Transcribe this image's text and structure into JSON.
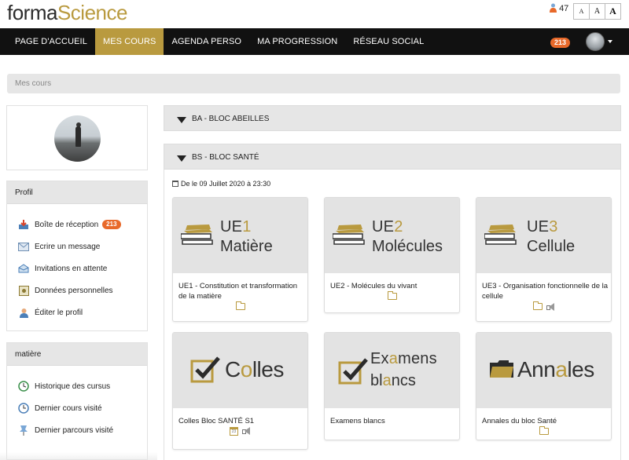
{
  "brand": {
    "part1": "forma",
    "part2": "Science"
  },
  "header": {
    "notifications_count": "47",
    "font_sizes": [
      "A",
      "A",
      "A"
    ]
  },
  "nav": {
    "items": [
      {
        "label": "PAGE D'ACCUEIL",
        "active": false
      },
      {
        "label": "MES COURS",
        "active": true
      },
      {
        "label": "AGENDA PERSO",
        "active": false
      },
      {
        "label": "MA PROGRESSION",
        "active": false
      },
      {
        "label": "RÉSEAU SOCIAL",
        "active": false
      }
    ],
    "badge": "213"
  },
  "breadcrumb": "Mes cours",
  "sidebar": {
    "profil": {
      "title": "Profil",
      "items": [
        {
          "label": "Boîte de réception",
          "count": "213",
          "icon": "inbox-icon"
        },
        {
          "label": "Ecrire un message",
          "icon": "envelope-icon"
        },
        {
          "label": "Invitations en attente",
          "icon": "invitation-icon"
        },
        {
          "label": "Données personnelles",
          "icon": "personal-data-icon"
        },
        {
          "label": "Éditer le profil",
          "icon": "edit-profile-icon"
        }
      ]
    },
    "matiere": {
      "title": "matière",
      "items": [
        {
          "label": "Historique des cursus",
          "icon": "history-icon"
        },
        {
          "label": "Dernier cours visité",
          "icon": "clock-icon"
        },
        {
          "label": "Dernier parcours visité",
          "icon": "pin-icon"
        }
      ]
    }
  },
  "blocks": [
    {
      "label": "BA - BLOC ABEILLES"
    },
    {
      "label": "BS - BLOC SANTÉ"
    }
  ],
  "date_range": "De le 09 Juillet 2020 à 23:30",
  "courses": [
    {
      "thumb_prefix": "UE",
      "thumb_num": "1",
      "thumb_word": "Matière",
      "title": "UE1 - Constitution et transformation de la matière",
      "icons": [
        "folder-icon"
      ]
    },
    {
      "thumb_prefix": "UE",
      "thumb_num": "2",
      "thumb_word": "Molécules",
      "title": "UE2 - Molécules du vivant",
      "icons": [
        "folder-icon"
      ]
    },
    {
      "thumb_prefix": "UE",
      "thumb_num": "3",
      "thumb_word": "Cellule",
      "title": "UE3 - Organisation fonctionnelle de la cellule",
      "icons": [
        "folder-icon",
        "megaphone-icon"
      ]
    },
    {
      "thumb_a": "C",
      "thumb_b": "o",
      "thumb_c": "lles",
      "title": "Colles Bloc SANTÉ S1",
      "icons": [
        "calendar-icon",
        "megaphone-icon"
      ],
      "cal_day": "23"
    },
    {
      "thumb_word1a": "Ex",
      "thumb_word1b": "a",
      "thumb_word1c": "mens",
      "thumb_word2a": "bl",
      "thumb_word2b": "a",
      "thumb_word2c": "ncs",
      "title": "Examens blancs",
      "icons": []
    },
    {
      "thumb_a": "Ann",
      "thumb_b": "a",
      "thumb_c": "les",
      "title": "Annales du bloc Santé",
      "icons": [
        "folder-icon"
      ]
    }
  ],
  "colors": {
    "accent": "#b99a3f",
    "badge": "#e8692a",
    "nav_bg": "#111111"
  }
}
